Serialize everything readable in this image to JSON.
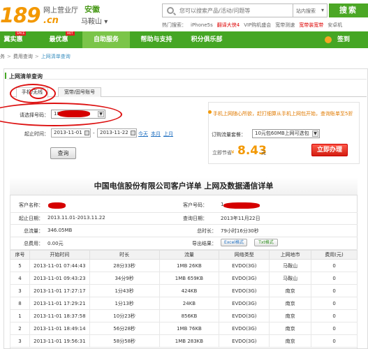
{
  "header": {
    "logo_num": "189",
    "logo_suffix": ".cn",
    "hall": "网上营业厅",
    "province": "安徽",
    "city": "马鞍山",
    "city_arrow": "▾",
    "search_placeholder": "您可以搜索产品/活动/问题等",
    "search_scope": "站内搜索",
    "search_button": "搜索",
    "hot_label": "热门搜索：",
    "hot_items": [
      "iPhone5s",
      "翻译大侠4",
      "VIP购机盛会",
      "宽带测速",
      "宽带装宽带",
      "安卓机"
    ]
  },
  "nav": {
    "items": [
      "翼实惠",
      "最优惠",
      "自助服务",
      "帮助与支持",
      "积分俱乐部"
    ],
    "badges": [
      "SPICE",
      "HOT"
    ],
    "signin": "签到"
  },
  "breadcrumb": {
    "items": [
      "务",
      "费用查询",
      "上网清单查询"
    ],
    "sep": ">"
  },
  "panel": {
    "title": "上网清单查询",
    "tab_phone": "手机/无线",
    "tab_broadband": "宽带/固号账号",
    "label_number": "请选择号码：",
    "number_value": "18",
    "label_time": "起止时间：",
    "date_start": "2013-11-01",
    "date_sep": "-",
    "date_end": "2013-11-22",
    "quick_today": "今天",
    "quick_month": "本月",
    "quick_last": "上月",
    "query_button": "查询",
    "promo_text": "手机上网随心所欲，赶打细算从手机上网包开始，查询账单至5折",
    "promo_label": "订购流量套餐：",
    "promo_select": "10元包60MB上网可选包",
    "save_label": "立即节省",
    "save_currency": "¥",
    "save_value": "8.43",
    "save_unit": "元",
    "order_button": "立即办理"
  },
  "bill": {
    "title": "中国电信股份有限公司客户详单  上网及数据通信详单",
    "customer_name_label": "客户名称：",
    "customer_no_label": "客户号码：",
    "customer_no_value": "1",
    "query_date_label": "起止日期：",
    "query_date_value": "2013.11.01-2013.11.22",
    "query_time_label": "查询日期：",
    "query_time_value": "2013年11月22日",
    "total_flow_label": "总流量：",
    "total_flow_value": "346.05MB",
    "total_duration_label": "总时长：",
    "total_duration_value": "79小时16分30秒",
    "total_fee_label": "总费用：",
    "total_fee_value": "0.00元",
    "export_label": "导出结果：",
    "export_excel": "Excel格式",
    "export_txt": "Txt格式",
    "columns": [
      "序号",
      "开始时间",
      "时长",
      "流量",
      "网络类型",
      "上网地市",
      "费用(元)"
    ],
    "rows": [
      [
        "5",
        "2013-11-01 07:44:43",
        "28分33秒",
        "1MB 26KB",
        "EVDO(3G)",
        "马鞍山",
        "0"
      ],
      [
        "4",
        "2013-11-01 09:43:23",
        "34分9秒",
        "1MB 659KB",
        "EVDO(3G)",
        "马鞍山",
        "0"
      ],
      [
        "3",
        "2013-11-01 17:27:17",
        "1分43秒",
        "424KB",
        "EVDO(3G)",
        "南京",
        "0"
      ],
      [
        "8",
        "2013-11-01 17:29:21",
        "1分13秒",
        "24KB",
        "EVDO(3G)",
        "南京",
        "0"
      ],
      [
        "1",
        "2013-11-01 18:37:58",
        "10分23秒",
        "856KB",
        "EVDO(3G)",
        "南京",
        "0"
      ],
      [
        "2",
        "2013-11-01 18:49:14",
        "56分28秒",
        "1MB 76KB",
        "EVDO(3G)",
        "南京",
        "0"
      ],
      [
        "3",
        "2013-11-01 19:56:31",
        "58分58秒",
        "1MB 283KB",
        "EVDO(3G)",
        "南京",
        "0"
      ]
    ]
  },
  "colors": {
    "brand_green": "#45a624",
    "logo_orange": "#f39800",
    "annotation_red": "#d11111"
  }
}
